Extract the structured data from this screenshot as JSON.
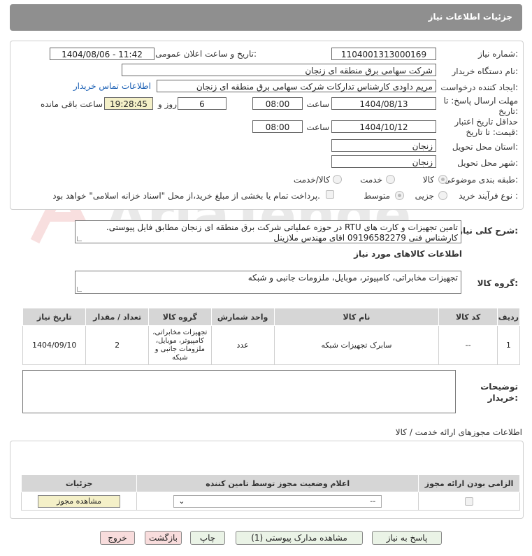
{
  "header": {
    "title": "جزئیات اطلاعات نیاز"
  },
  "fields": {
    "need_number_label": "شماره نیاز:",
    "need_number": "1104001313000169",
    "announce_label": "تاریخ و ساعت اعلان عمومی:",
    "announce_value": "1404/08/06 - 11:42",
    "buyer_label": "نام دستگاه خریدار:",
    "buyer_value": "شرکت سهامی برق منطقه ای زنجان",
    "creator_label": "ایجاد کننده درخواست:",
    "creator_value": "مریم داودی کارشناس تدارکات شرکت سهامی برق منطقه ای زنجان",
    "contact_link": "اطلاعات تماس خریدار",
    "deadline_label_1": "مهلت ارسال پاسخ: تا",
    "deadline_label_2": "تاریخ:",
    "deadline_date": "1404/08/13",
    "time_label": "ساعت",
    "deadline_time": "08:00",
    "days_value": "6",
    "days_label": "روز و",
    "remaining_time": "19:28:45",
    "remaining_label": "ساعت باقی مانده",
    "validity_label_1": "حداقل تاریخ اعتبار",
    "validity_label_2": "قیمت: تا تاریخ:",
    "validity_date": "1404/10/12",
    "validity_time": "08:00",
    "province_label": "استان محل تحویل:",
    "province_value": "زنجان",
    "city_label": "شهر محل تحویل:",
    "city_value": "زنجان",
    "category_label": "طبقه بندی موضوعی:",
    "category_options": [
      "کالا",
      "خدمت",
      "کالا/خدمت"
    ],
    "process_label": "نوع فرآیند خرید :",
    "process_options": [
      "جزیی",
      "متوسط"
    ],
    "payment_note": "پرداخت تمام یا بخشی از مبلغ خرید،از محل \"اسناد خزانه اسلامی\" خواهد بود."
  },
  "description": {
    "label": "شرح کلی نیاز:",
    "line1": "تامین تجهیزات و کارت های RTU در حوزه عملیاتی شرکت برق منطقه ای زنجان مطابق فایل پیوستی.",
    "line2": "کارشناس فنی 09196582279 اقای مهندس ملازینل"
  },
  "goods": {
    "section_title": "اطلاعات کالاهای مورد نیاز",
    "group_label": "گروه کالا:",
    "group_value": "تجهیزات مخابراتی، کامپیوتر، موبایل، ملزومات جانبی و شبکه",
    "columns": [
      "ردیف",
      "کد کالا",
      "نام کالا",
      "واحد شمارش",
      "گروه کالا",
      "تعداد / مقدار",
      "تاریخ نیاز"
    ],
    "rows": [
      {
        "idx": "1",
        "code": "--",
        "name": "سابرک تجهیزات شبکه",
        "unit": "عدد",
        "group": "تجهیزات مخابراتی، کامپیوتر، موبایل، ملزومات جانبی و شبکه",
        "qty": "2",
        "date": "1404/09/10"
      }
    ]
  },
  "buyer_notes": {
    "label_1": "توضیحات",
    "label_2": "خریدار:"
  },
  "permits": {
    "title": "اطلاعات مجوزهای ارائه خدمت / کالا",
    "columns": [
      "الزامی بودن ارائه مجوز",
      "اعلام وضعیت مجوز توسط تامین کننده",
      "جزئیات"
    ],
    "select_value": "--",
    "view_button": "مشاهده مجوز"
  },
  "buttons": {
    "reply": "پاسخ به نیاز",
    "attachments": "مشاهده مدارک پیوستی (1)",
    "print": "چاپ",
    "back": "بازگشت",
    "exit": "خروج"
  },
  "watermark": {
    "text": "AriaTender.net"
  }
}
